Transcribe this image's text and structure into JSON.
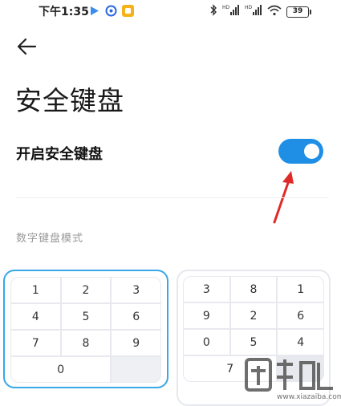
{
  "status_bar": {
    "time": "下午1:35",
    "battery": "39",
    "app_icons": [
      {
        "name": "play-icon",
        "color": "#3b8cf0"
      },
      {
        "name": "baidu-icon",
        "color": "#2b68e0"
      },
      {
        "name": "yellow-app-icon",
        "color": "#f6b21b"
      }
    ],
    "signal_tag": "HD"
  },
  "header": {
    "back_icon": "arrow-left-icon",
    "title": "安全键盘"
  },
  "settings": {
    "enable_label": "开启安全键盘",
    "enable_state": true,
    "accent_color": "#1f8fe6"
  },
  "keypad_mode": {
    "section_label": "数字键盘模式",
    "selected": "sequential",
    "sequential_rows": [
      [
        "1",
        "2",
        "3"
      ],
      [
        "4",
        "5",
        "6"
      ],
      [
        "7",
        "8",
        "9"
      ],
      [
        "0",
        ""
      ]
    ],
    "random_rows": [
      [
        "3",
        "8",
        "1"
      ],
      [
        "9",
        "2",
        "6"
      ],
      [
        "0",
        "5",
        "4"
      ],
      [
        "7"
      ]
    ]
  },
  "watermark": {
    "brand": "下载吧",
    "url": "www.xiazaiba.com"
  },
  "annotation_color": "#e02a2a"
}
